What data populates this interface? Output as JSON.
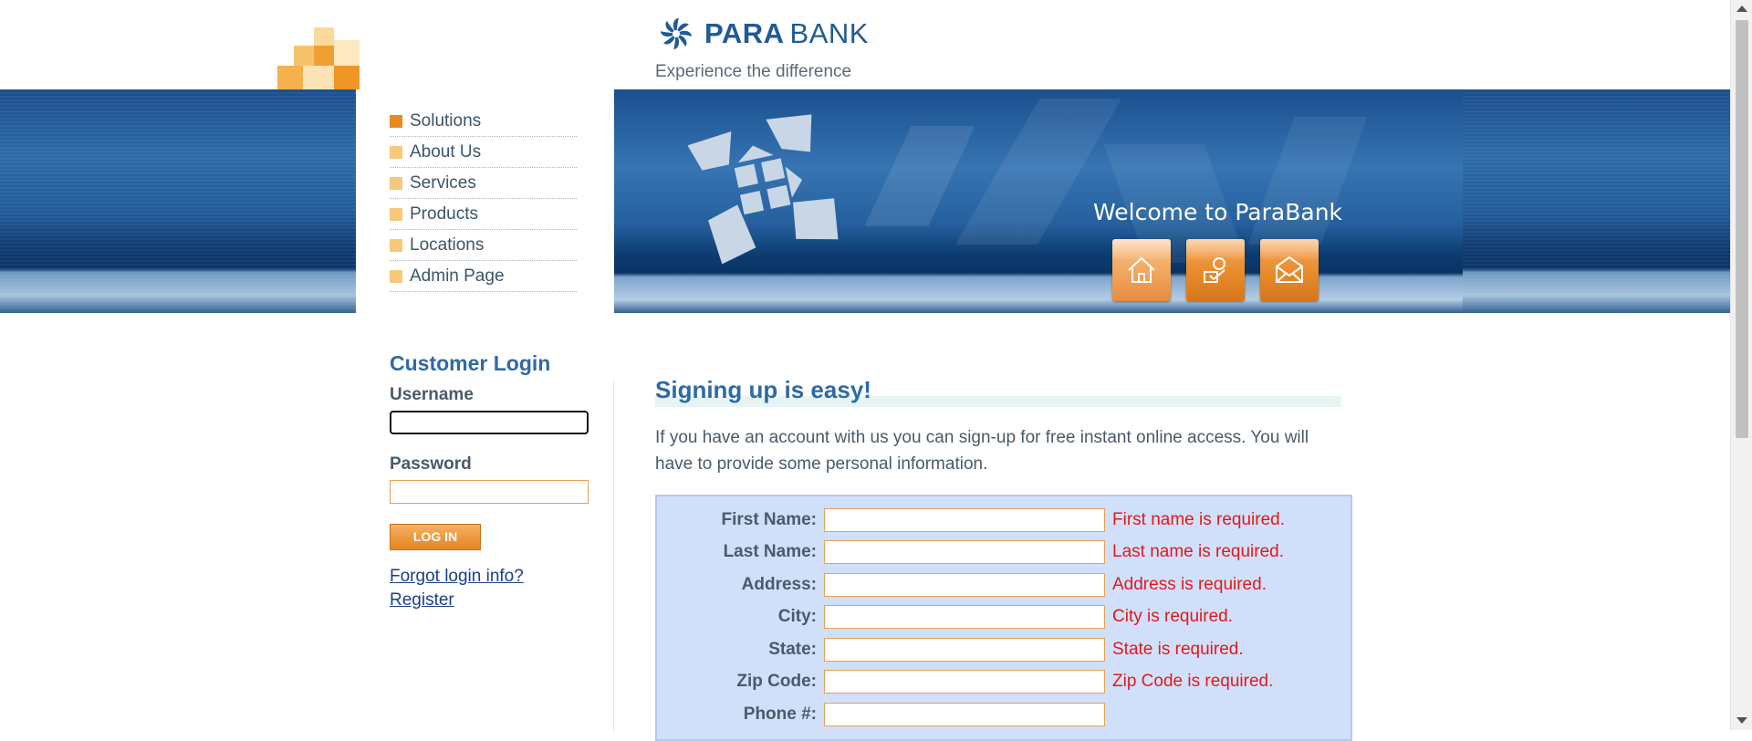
{
  "brand": {
    "name_part1": "PARA",
    "name_part2": "BANK",
    "caption": "Experience the difference",
    "colors": {
      "brand_blue": "#1f5b94",
      "accent_orange": "#e98a1e",
      "error_red": "#e01a1a",
      "form_bg": "#d1e0fa"
    }
  },
  "header": {
    "welcome": "Welcome to ParaBank",
    "icons": [
      "home-icon",
      "about-icon",
      "contact-icon"
    ]
  },
  "nav": {
    "items": [
      {
        "label": "Solutions",
        "active": true
      },
      {
        "label": "About Us"
      },
      {
        "label": "Services"
      },
      {
        "label": "Products"
      },
      {
        "label": "Locations"
      },
      {
        "label": "Admin Page"
      }
    ]
  },
  "login": {
    "title": "Customer Login",
    "username_label": "Username",
    "username_value": "",
    "password_label": "Password",
    "password_value": "",
    "login_button": "LOG IN",
    "forgot_link": "Forgot login info?",
    "register_link": "Register"
  },
  "main": {
    "title": "Signing up is easy!",
    "intro": "If you have an account with us you can sign-up for free instant online access. You will have to provide some personal information.",
    "fields": [
      {
        "label": "First Name:",
        "value": "",
        "error": "First name is required."
      },
      {
        "label": "Last Name:",
        "value": "",
        "error": "Last name is required."
      },
      {
        "label": "Address:",
        "value": "",
        "error": "Address is required."
      },
      {
        "label": "City:",
        "value": "",
        "error": "City is required."
      },
      {
        "label": "State:",
        "value": "",
        "error": "State is required."
      },
      {
        "label": "Zip Code:",
        "value": "",
        "error": "Zip Code is required."
      },
      {
        "label": "Phone #:",
        "value": "",
        "error": ""
      }
    ]
  }
}
